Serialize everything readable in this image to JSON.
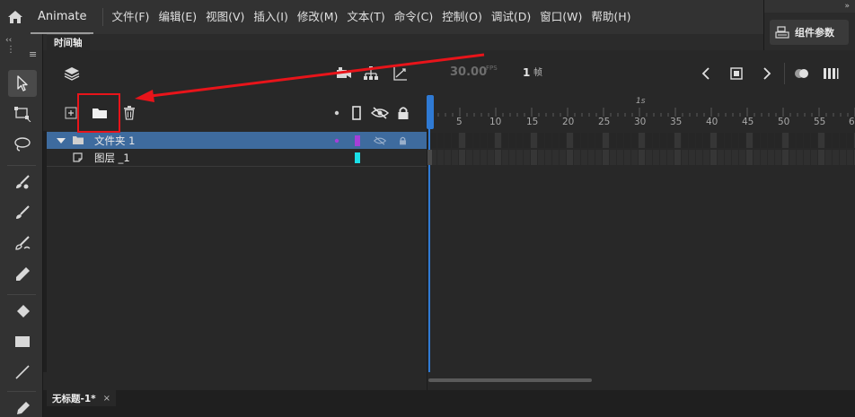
{
  "menubar": {
    "app_name": "Animate",
    "items": [
      "文件(F)",
      "编辑(E)",
      "视图(V)",
      "插入(I)",
      "修改(M)",
      "文本(T)",
      "命令(C)",
      "控制(O)",
      "调试(D)",
      "窗口(W)",
      "帮助(H)"
    ]
  },
  "props_panel": {
    "collapse_glyph": "»",
    "button_label": "组件参数"
  },
  "toolbox": {
    "collapse_glyph": "‹‹",
    "tools": [
      "selection-arrow-icon",
      "free-transform-icon",
      "lasso-icon",
      "paint-brush-icon",
      "brush-icon",
      "fluid-brush-icon",
      "pencil-icon",
      "eraser-icon",
      "rectangle-icon",
      "line-icon",
      "pen-icon"
    ]
  },
  "timeline": {
    "tab_label": "时间轴",
    "fps_value": "30.00",
    "fps_unit": "FPS",
    "current_frame": "1",
    "frame_unit": "帧",
    "ruler_second_label": "1s",
    "ruler_numbers": [
      "5",
      "10",
      "15",
      "20",
      "25",
      "30",
      "35",
      "40",
      "45",
      "50",
      "55",
      "6"
    ],
    "layers": [
      {
        "name": "文件夹 1",
        "type": "folder",
        "selected": true,
        "color": "#a53fd8"
      },
      {
        "name": "图层 _1",
        "type": "layer",
        "selected": false,
        "color": "#1ae0e8"
      }
    ]
  },
  "document": {
    "tab_title": "无标题-1*",
    "close_glyph": "×"
  },
  "colors": {
    "accent_blue": "#2f7ad4",
    "selection_row": "#3e6b9e",
    "annotation_red": "#e8141a"
  }
}
